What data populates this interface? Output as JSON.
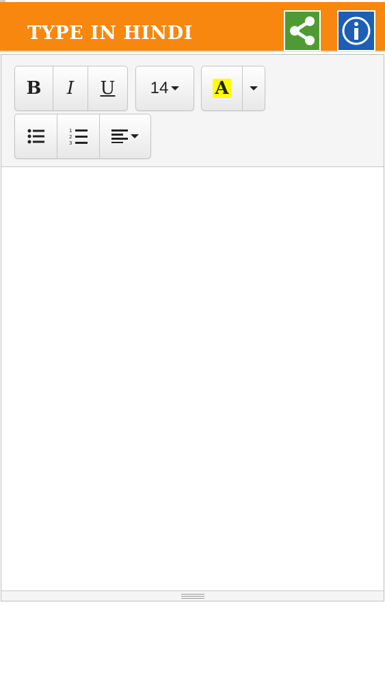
{
  "header": {
    "title": "TYPE IN HINDI",
    "colors": {
      "background": "#f7870f",
      "share": "#4f9a35",
      "info": "#1c5fb4"
    },
    "share_icon": "share-icon",
    "info_icon": "info-icon"
  },
  "toolbar": {
    "bold_label": "B",
    "italic_label": "I",
    "underline_label": "U",
    "font_size": "14",
    "highlight_label": "A",
    "highlight_color": "#ffff00",
    "icons": {
      "unordered_list": "unordered-list-icon",
      "ordered_list": "ordered-list-icon",
      "align": "align-left-icon",
      "dropdown": "chevron-down-icon"
    }
  },
  "editor": {
    "content": ""
  }
}
